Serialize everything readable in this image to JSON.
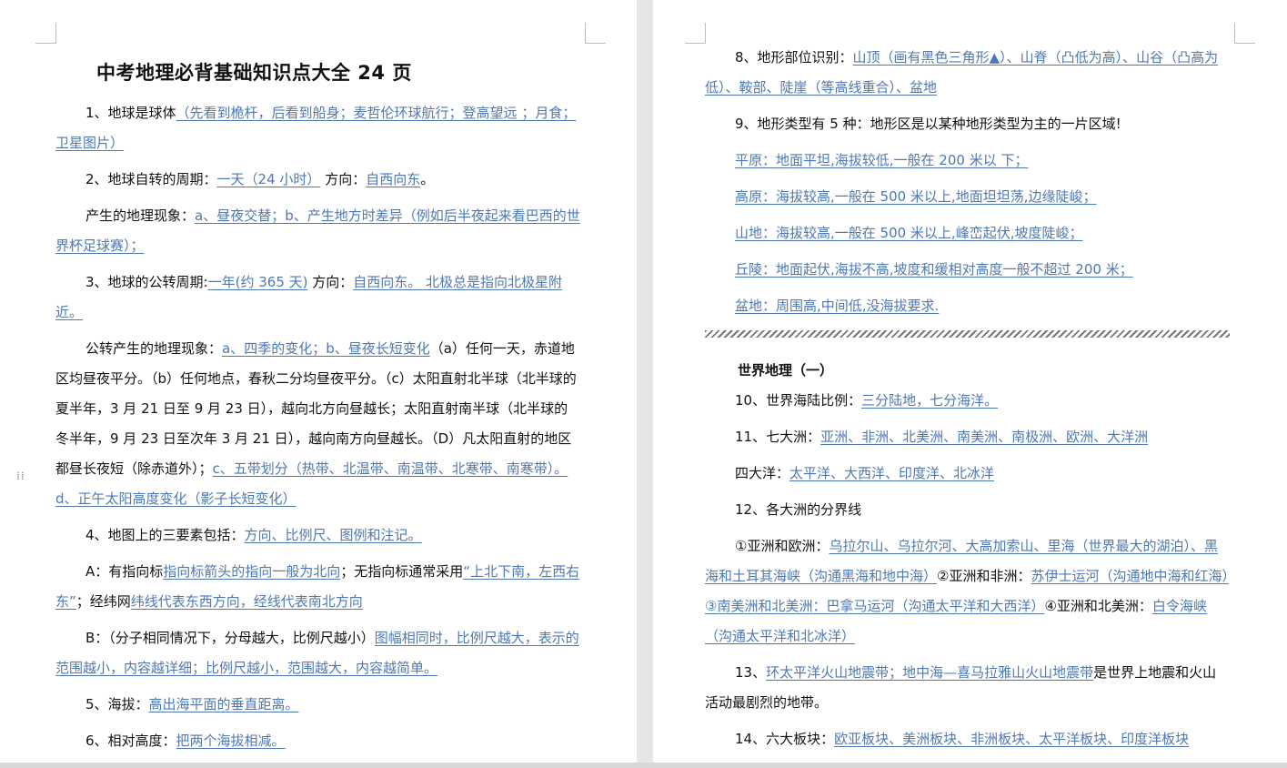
{
  "left": {
    "title": "中考地理必背基础知识点大全 24 页",
    "p1_a": "1、地球是球体",
    "p1_b": "（先看到桅杆，后看到船身；麦哲伦环球航行；登高望远 ；月食；卫星图片）",
    "p2_a": "2、地球自转的周期：",
    "p2_b": "一天（24 小时）",
    "p2_c": "方向：",
    "p2_d": "自西向东",
    "p2_e": "。",
    "p3_a": "产生的地理现象：",
    "p3_b": "a、昼夜交替；b、产生地方时差异（例如后半夜起来看巴西的世界杯足球赛）；",
    "p4_a": "3、地球的公转周期:",
    "p4_b": "一年(约 365 天)",
    "p4_c": "方向：",
    "p4_d": "自西向东。 北极总是指向北极星附近。",
    "p5_a": "公转产生的地理现象：",
    "p5_b": "a、四季的变化；b、昼夜长短变化",
    "p5_c": "（a）任何一天，赤道地区均昼夜平分。（b）任何地点，春秋二分均昼夜平分。（c）太阳直射北半球（北半球的夏半年，3 月 21 日至 9 月 23 日），越向北方向昼越长；太阳直射南半球（北半球的冬半年，9 月 23 日至次年 3 月 21 日），越向南方向昼越长。（D）凡太阳直射的地区都昼长夜短（除赤道外）；",
    "p5_d": "c、五带划分（热带、北温带、南温带、北寒带、南寒带）。d、正午太阳高度变化（影子长短变化）",
    "p6_a": "4、地图上的三要素包括：",
    "p6_b": "方向、比例尺、图例和注记。",
    "p7_a": "A：有指向标",
    "p7_b": "指向标箭头的指向一般为北向",
    "p7_c": "；无指向标通常采用",
    "p7_d": "“上北下南，左西右东”",
    "p7_e": "；经纬网",
    "p7_f": "纬线代表东西方向，经线代表南北方向",
    "p8_a": "B：（分子相同情况下，分母越大，比例尺越小）",
    "p8_b": "图幅相同时，比例尺越大，表示的范围越小，内容越详细；比例尺越小，范围越大，内容越简单。",
    "p9_a": "5、海拔：",
    "p9_b": "高出海平面的垂直距离。",
    "p10_a": "6、相对高度：",
    "p10_b": "把两个海拔相减。"
  },
  "right": {
    "r1_a": "8、地形部位识别：",
    "r1_b": "山顶（画有黑色三角形▲）、山脊（凸低为高）、山谷（凸高为低）、鞍部、陡崖（等高线重合）、盆地",
    "r2": "9、地形类型有 5 种：地形区是以某种地形类型为主的一片区域",
    "r2_end": "!",
    "r3": "平原：地面平坦,海拔较低,一般在 200 米以 下；",
    "r4": "高原：海拔较高,一般在 500 米以上,地面坦坦荡,边缘陡峻；",
    "r5": "山地：海拔较高,一般在 500 米以上,峰峦起伏,坡度陡峻；",
    "r6": "丘陵：地面起伏,海拔不高,坡度和缓相对高度一般不超过 200 米；",
    "r7": "盆地：周围高,中间低,没海拔要求.",
    "section": "世界地理（一）",
    "r8_a": "10、世界海陆比例：",
    "r8_b": "三分陆地，七分海洋。",
    "r9_a": "11、七大洲：",
    "r9_b": "亚洲、非洲、北美洲、南美洲、南极洲、欧洲、大洋洲",
    "r10_a": "四大洋：",
    "r10_b": "太平洋、大西洋、印度洋、北冰洋",
    "r11": "12、各大洲的分界线",
    "r12_a": "①亚洲和欧洲：",
    "r12_b": "乌拉尔山、乌拉尔河、大高加索山、里海（世界最大的湖泊）、黑海和土耳其海峡（沟通黑海和地中海）",
    "r12_c": "②亚洲和非洲：",
    "r12_d": "苏伊士运河（沟通地中海和红海）③南美洲和北美洲：巴拿马运河（沟通太平洋和大西洋）",
    "r12_e": "④亚洲和北美洲：",
    "r12_f": "白令海峡（沟通太平洋和北冰洋）",
    "r13_a": "13、",
    "r13_b": "环太平洋火山地震带；地中海—喜马拉雅山火山地震带",
    "r13_c": "是世界上地震和火山活动最剧烈的地带。",
    "r14_a": "14、六大板块：",
    "r14_b": "欧亚板块、美洲板块、非洲板块、太平洋板块、印度洋板块"
  }
}
